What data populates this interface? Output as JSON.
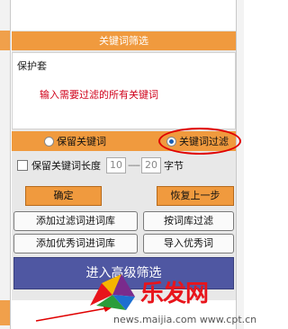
{
  "title": "关键词筛选",
  "keyword_box": {
    "text": "保护套",
    "placeholder": "输入需要过滤的所有关键词"
  },
  "mode": {
    "keep_label": "保留关键词",
    "filter_label": "关键词过滤",
    "selected": "filter"
  },
  "length": {
    "label": "保留关键词长度",
    "min": "10",
    "separator": "-----",
    "max": "20",
    "unit": "字节"
  },
  "buttons": {
    "confirm": "确定",
    "restore": "恢复上一步",
    "add_filter": "添加过滤词进词库",
    "filter_by_lib": "按词库过滤",
    "add_good": "添加优秀词进词库",
    "import_good": "导入优秀词",
    "enter_advanced": "进入高级筛选"
  },
  "watermark": {
    "brand": "乐发网",
    "url": "news.maijia.com www.cpt.cn"
  },
  "colors": {
    "accent": "#f09a3e",
    "primary": "#4f57a2",
    "highlight": "#e00000",
    "placeholder": "#d0021b"
  }
}
